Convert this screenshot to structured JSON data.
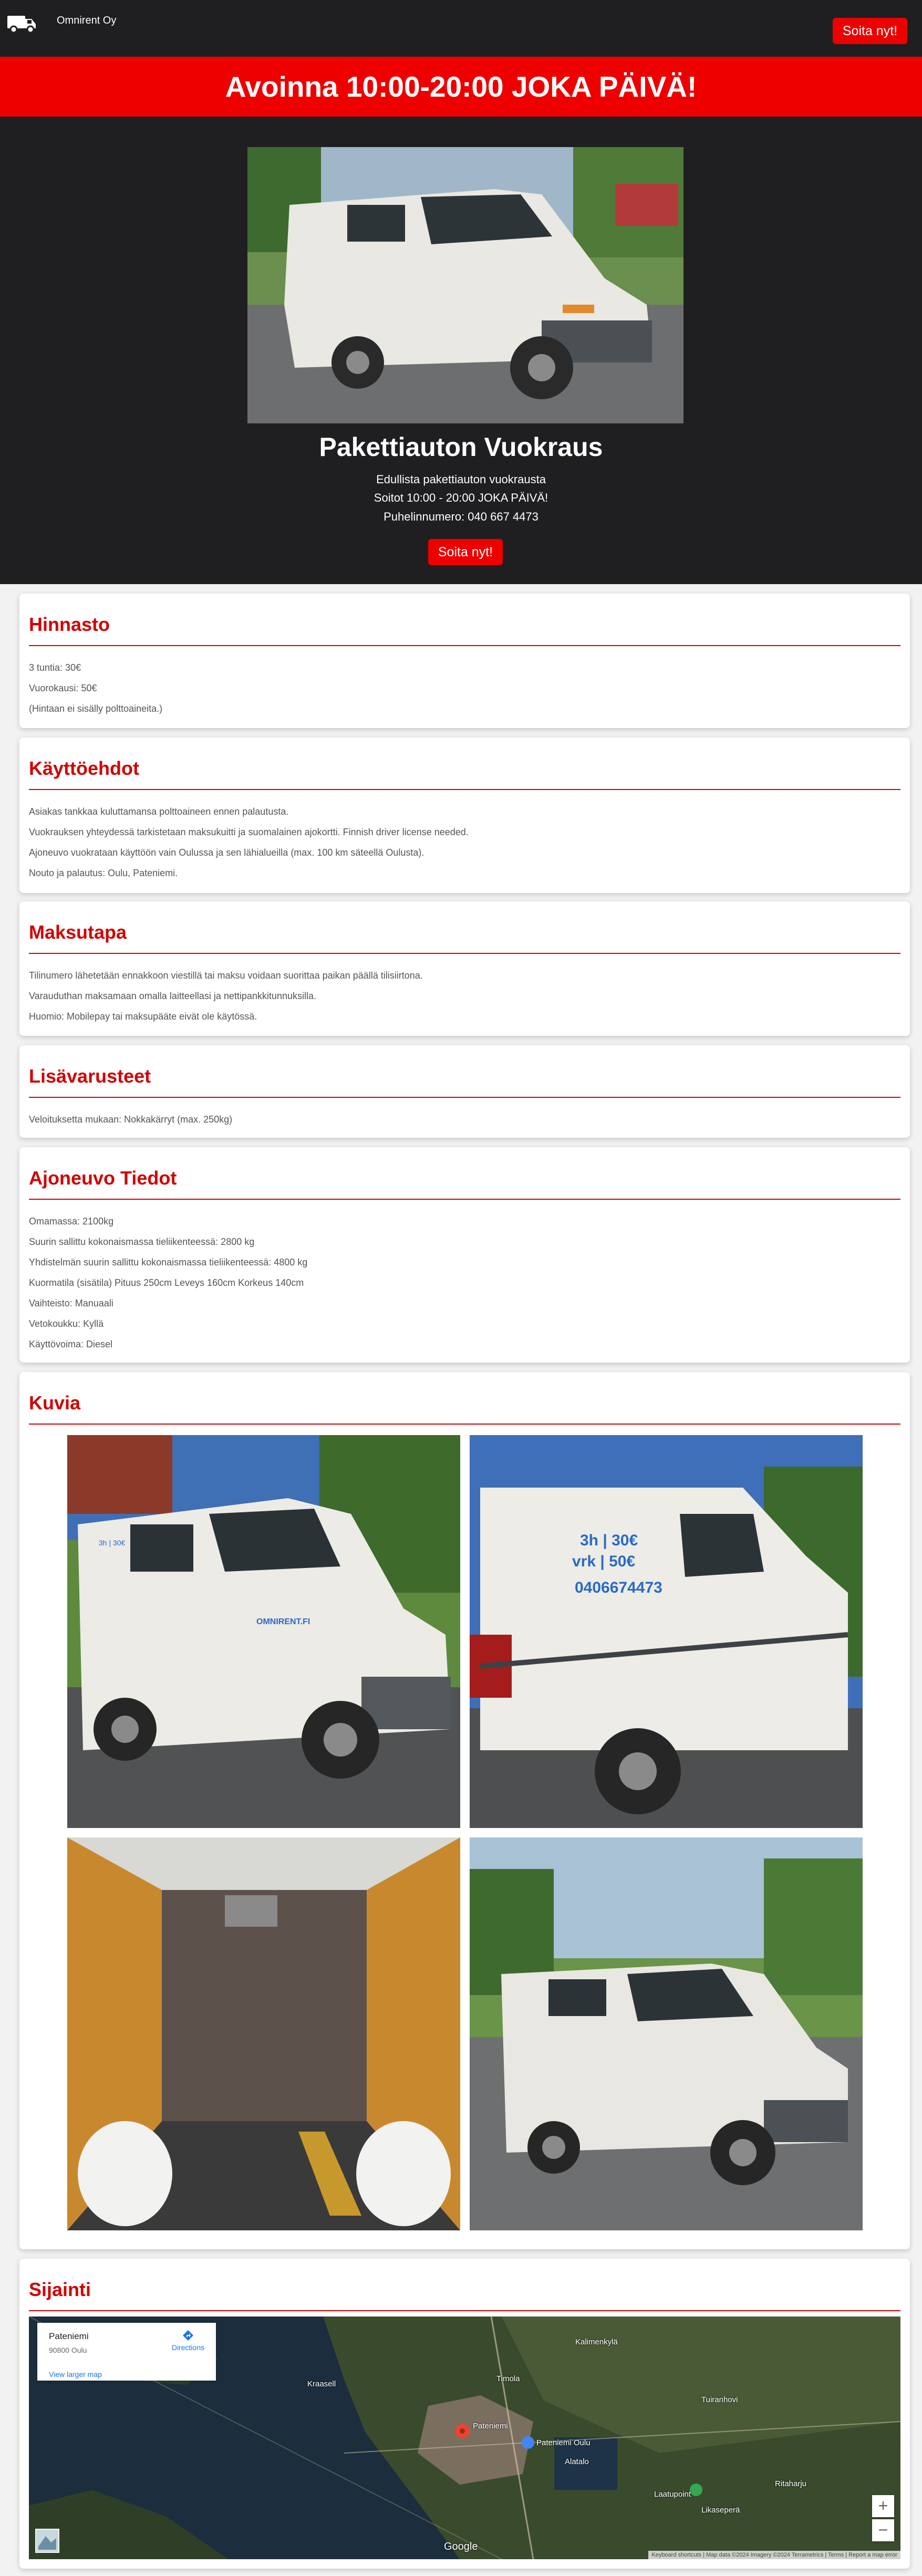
{
  "header": {
    "brand_name": "Omnirent Oy",
    "logo_icon": "van-icon",
    "call_button": "Soita nyt!"
  },
  "banner": {
    "text": "Avoinna 10:00-20:00 JOKA PÄIVÄ!"
  },
  "hero": {
    "title": "Pakettiauton Vuokraus",
    "lines": [
      "Edullista pakettiauton vuokrausta",
      "Soitot 10:00 - 20:00 JOKA PÄIVÄ!",
      "Puhelinnumero: 040 667 4473"
    ],
    "call_button": "Soita nyt!"
  },
  "sections": {
    "hinnasto": {
      "title": "Hinnasto",
      "lines": [
        "3 tuntia: 30€",
        "Vuorokausi: 50€",
        "(Hintaan ei sisälly polttoaineita.)"
      ]
    },
    "kayttoehdot": {
      "title": "Käyttöehdot",
      "lines": [
        "Asiakas tankkaa kuluttamansa polttoaineen ennen palautusta.",
        "Vuokrauksen yhteydessä tarkistetaan maksukuitti ja suomalainen ajokortti. Finnish driver license needed.",
        "Ajoneuvo vuokrataan käyttöön vain Oulussa ja sen lähialueilla (max. 100 km säteellä Oulusta).",
        "Nouto ja palautus: Oulu, Pateniemi."
      ]
    },
    "maksutapa": {
      "title": "Maksutapa",
      "lines": [
        "Tilinumero lähetetään ennakkoon viestillä tai maksu voidaan suorittaa paikan päällä tilisiirtona.",
        "Varauduthan maksamaan omalla laitteellasi ja nettipankkitunnuksilla.",
        "Huomio: Mobilepay tai maksupäätе eivät ole käytössä."
      ]
    },
    "lisavarusteet": {
      "title": "Lisävarusteet",
      "lines": [
        "Veloituksetta mukaan: Nokkakärryt (max. 250kg)"
      ]
    },
    "ajoneuvo": {
      "title": "Ajoneuvo Tiedot",
      "lines": [
        "Omamassa: 2100kg",
        "Suurin sallittu kokonaismassa tieliikenteessä: 2800 kg",
        "Yhdistelmän suurin sallittu kokonaismassa tieliikenteessä: 4800 kg",
        "Kuormatila (sisätila) Pituus 250cm Leveys 160cm Korkeus 140cm",
        "Vaihteisto: Manuaali",
        "Vetokoukku: Kyllä",
        "Käyttövoima: Diesel"
      ]
    },
    "kuvia": {
      "title": "Kuvia"
    },
    "sijainti": {
      "title": "Sijainti",
      "map": {
        "place": "Pateniemi",
        "address": "90800 Oulu",
        "directions": "Directions",
        "larger_map": "View larger map",
        "labels": [
          "Kalimenkylä",
          "Kraasell",
          "Timola",
          "Pateniemi",
          "Pateniemi Oulu",
          "Alatalo",
          "Tuiranhovi",
          "Laatupoint",
          "Likaseperä",
          "Ritaharju"
        ],
        "attribution": "Keyboard shortcuts | Map data ©2024 Imagery ©2024 Terrametrics | Terms | Report a map error",
        "google": "Google"
      }
    }
  },
  "van_decal": {
    "line1": "3h | 30€",
    "line2": "vrk | 50€",
    "phone": "0406674473",
    "site": "OMNIRENT.FI"
  }
}
